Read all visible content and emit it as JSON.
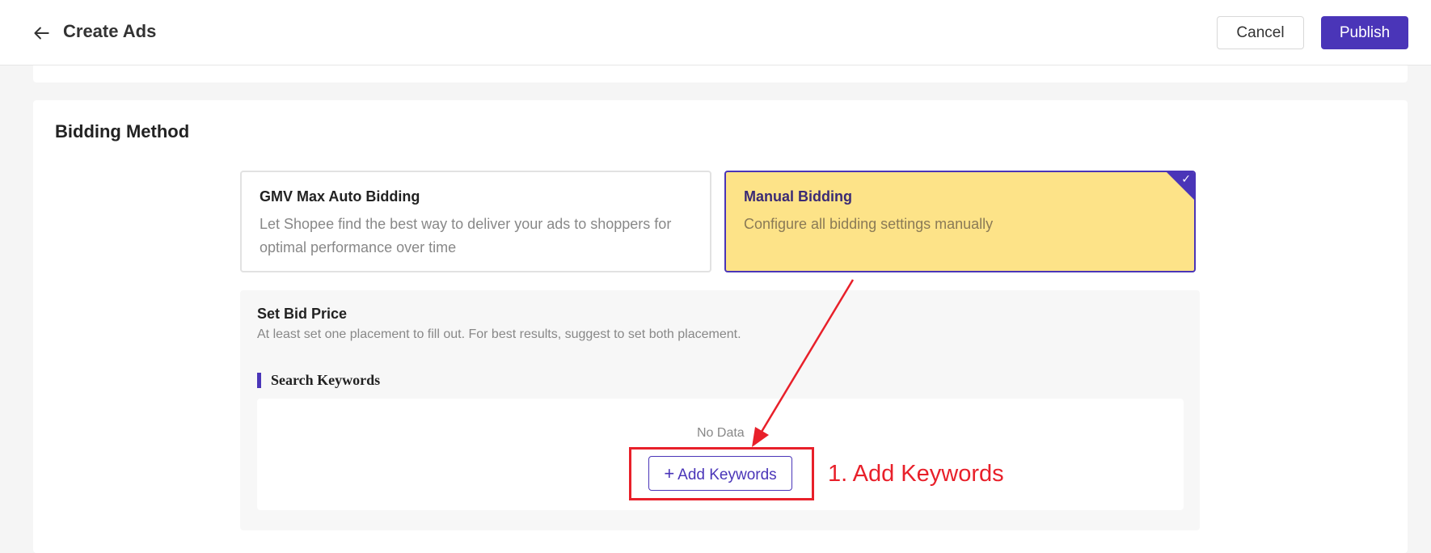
{
  "header": {
    "title": "Create Ads",
    "back_icon": "arrow-left-icon",
    "cancel_label": "Cancel",
    "publish_label": "Publish",
    "accent_color": "#4a35b8"
  },
  "bidding": {
    "section_title": "Bidding Method",
    "options": [
      {
        "title": "GMV Max Auto Bidding",
        "description": "Let Shopee find the best way to deliver your ads to shoppers for optimal performance over time",
        "selected": false
      },
      {
        "title": "Manual Bidding",
        "description": "Configure all bidding settings manually",
        "selected": true,
        "selected_color": "#fde388"
      }
    ],
    "selected_icon": "checkmark-icon"
  },
  "bid_price": {
    "title": "Set Bid Price",
    "subtitle": "At least set one placement to fill out. For best results, suggest to set both placement."
  },
  "keywords": {
    "title": "Search Keywords",
    "empty_text": "No Data",
    "add_button_label": "Add Keywords",
    "add_icon": "plus-icon"
  },
  "annotation": {
    "text": "1. Add Keywords",
    "color": "#e8202a"
  }
}
